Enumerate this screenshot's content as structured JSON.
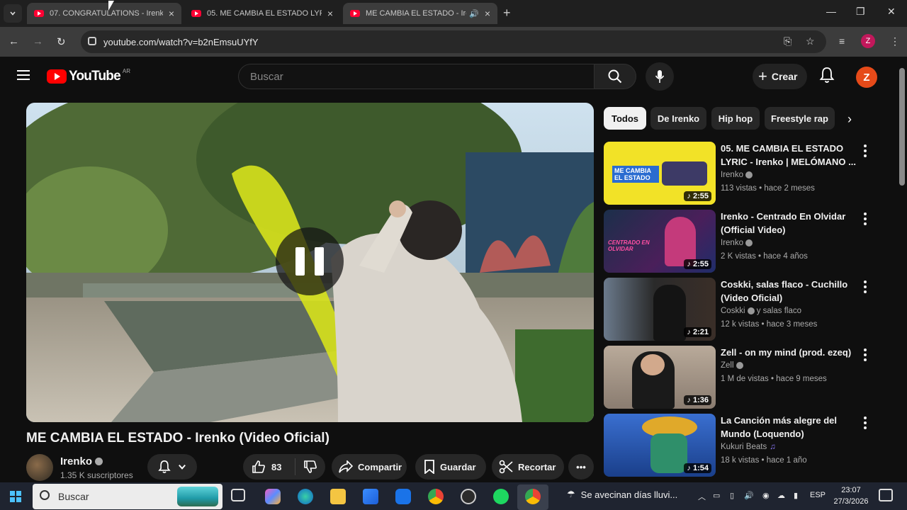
{
  "browser": {
    "tabs": [
      {
        "title": "07. CONGRATULATIONS - Irenko",
        "close": "×"
      },
      {
        "title": "05. ME CAMBIA EL ESTADO LYRIC",
        "close": "×"
      },
      {
        "title": "ME CAMBIA EL ESTADO - Irenko",
        "close": "×",
        "audio_icon": "speaker-icon"
      }
    ],
    "new_tab": "+",
    "window_controls": {
      "minimize": "—",
      "maximize": "❐",
      "close": "✕"
    },
    "url": "youtube.com/watch?v=b2nEmsuUYfY",
    "profile_initial": "Z"
  },
  "yt": {
    "logo_text": "YouTube",
    "region": "AR",
    "search_placeholder": "Buscar",
    "create_label": "Crear",
    "avatar_initial": "Z"
  },
  "video": {
    "title": "ME CAMBIA EL ESTADO - Irenko (Video Oficial)",
    "state": "paused-overlay",
    "channel": {
      "name": "Irenko",
      "subscribers": "1.35 K suscriptores"
    },
    "actions": {
      "likes": "83",
      "share": "Compartir",
      "save": "Guardar",
      "clip": "Recortar",
      "more": "•••"
    }
  },
  "chips": [
    "Todos",
    "De Irenko",
    "Hip hop",
    "Freestyle rap"
  ],
  "recommendations": [
    {
      "title": "05. ME CAMBIA EL ESTADO LYRIC - Irenko | MELÓMANO ...",
      "channel": "Irenko",
      "verified": true,
      "meta": "113 vistas • hace 2 meses",
      "duration": "2:55",
      "thumb_text": "ME CAMBIA EL ESTADO"
    },
    {
      "title": "Irenko - Centrado En Olvidar (Official Video)",
      "channel": "Irenko",
      "verified": true,
      "meta": "2 K vistas • hace 4 años",
      "duration": "2:55",
      "thumb_text": "CENTRADO EN OLVIDAR"
    },
    {
      "title": "Coskki, salas flaco - Cuchillo (Video Oficial)",
      "channel": "Coskki",
      "channel_suffix": "y salas flaco",
      "verified": true,
      "meta": "12 k vistas • hace 3 meses",
      "duration": "2:21"
    },
    {
      "title": "Zell - on my mind (prod. ezeq)",
      "channel": "Zell",
      "verified": true,
      "meta": "1 M de vistas • hace 9 meses",
      "duration": "1:36"
    },
    {
      "title": "La Canción más alegre del Mundo (Loquendo)",
      "channel": "Kukuri Beats",
      "verified": false,
      "music": true,
      "meta": "18 k vistas • hace 1 año",
      "duration": "1:54"
    }
  ],
  "taskbar": {
    "search_placeholder": "Buscar",
    "weather": "Se avecinan días lluvi...",
    "language": "ESP",
    "time": "23:07",
    "date": "27/3/2026"
  },
  "colors": {
    "yt_red": "#ff0000",
    "bg": "#0f0f0f",
    "chip_active": "#f1f1f1",
    "avatar": "#e64a19"
  }
}
